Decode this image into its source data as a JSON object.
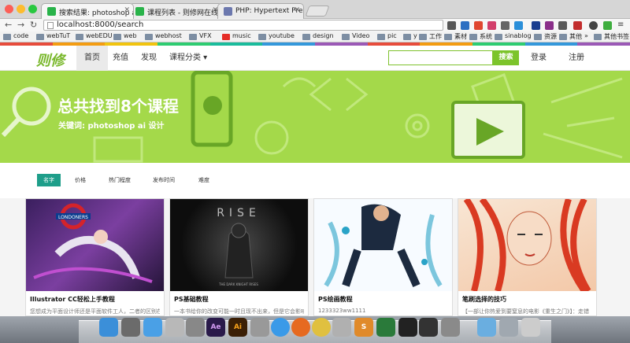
{
  "tabs": [
    {
      "title": "搜索结果: photoshop ai 设计 ·",
      "active": true,
      "favicon_color": "#29b34a"
    },
    {
      "title": "课程列表 - 则修网在线视频教程",
      "active": false,
      "favicon_color": "#29b34a"
    },
    {
      "title": "PHP: Hypertext Preprocess",
      "active": false,
      "favicon_color": "#6c78ae"
    }
  ],
  "url": "localhost:8000/search",
  "bookmarks": [
    "code",
    "webTuT",
    "webEDU",
    "web",
    "webhost",
    "VFX",
    "music",
    "youtube",
    "design",
    "Video",
    "pic",
    "y",
    "工作",
    "素材",
    "系统",
    "sinablog",
    "资源",
    "其他",
    "»",
    "其他书签"
  ],
  "site": {
    "logo": "则修",
    "nav": [
      "首页",
      "充值",
      "发现",
      "课程分类 ▾"
    ],
    "search_placeholder": "",
    "search_button": "搜索",
    "login": "登录",
    "register": "注册",
    "accent": "#7cc42b"
  },
  "banner": {
    "title": "总共找到8个课程",
    "subtitle": "关键词: photoshop ai 设计",
    "bg": "#a4d94a"
  },
  "sort": [
    "名字",
    "价格",
    "热门程度",
    "发布时间",
    "难度"
  ],
  "courses": [
    {
      "title": "Illustrator CC轻松上手教程",
      "desc": "您想成为平面设计师还是平面软件工人，二者的区别在"
    },
    {
      "title": "PS基础教程",
      "desc": "一本书给你的改变可能一时且现不出来，但是它会影响"
    },
    {
      "title": "PS绘画教程",
      "desc": "1233323ww1111"
    },
    {
      "title": "笔刷选择的技巧",
      "desc": "【一部让你热爱到要窒息的电影《重生之门》】：走错"
    }
  ],
  "thumb_texts": [
    "LONDONERS",
    "RISE",
    "THE DARK KNIGHT RISES"
  ]
}
